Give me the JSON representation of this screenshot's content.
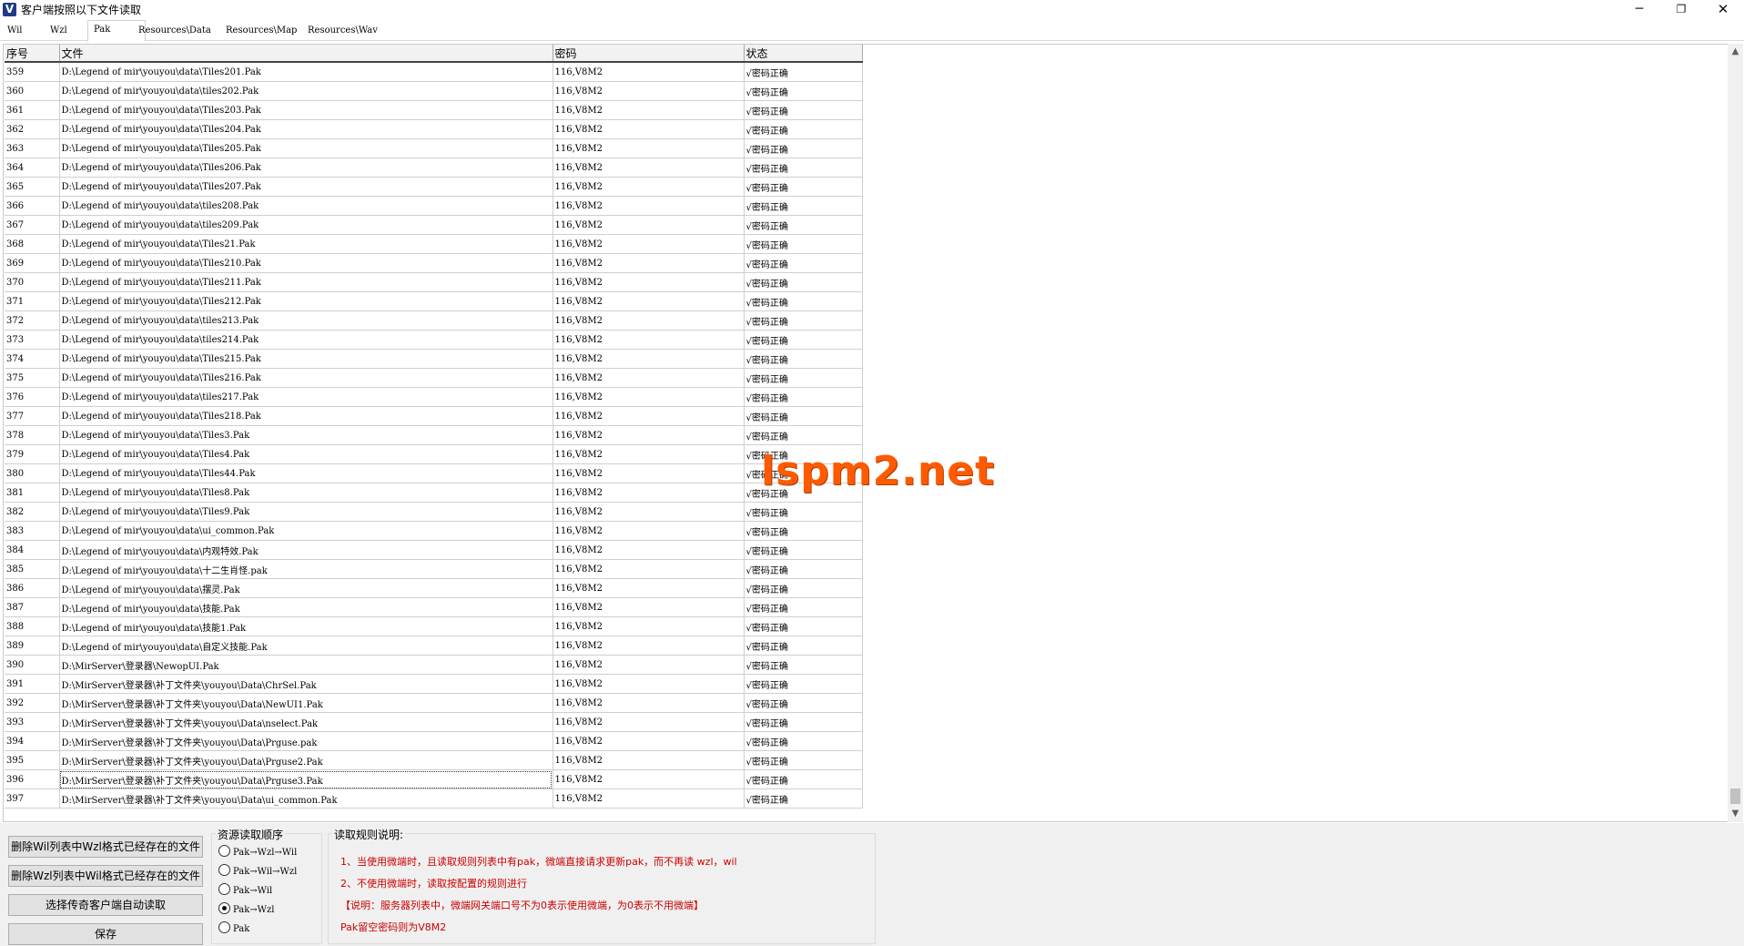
{
  "window": {
    "title": "客户端按照以下文件读取",
    "app_icon_letter": "V",
    "minimize_glyph": "─",
    "maximize_glyph": "❐",
    "close_glyph": "✕"
  },
  "tabs": [
    {
      "label": "Wil",
      "active": false
    },
    {
      "label": "Wzl",
      "active": false
    },
    {
      "label": "Pak",
      "active": true
    },
    {
      "label": "Resources\\Data",
      "active": false
    },
    {
      "label": "Resources\\Map",
      "active": false
    },
    {
      "label": "Resources\\Wav",
      "active": false
    }
  ],
  "table": {
    "headers": {
      "seq": "序号",
      "file": "文件",
      "password": "密码",
      "status": "状态"
    },
    "rows": [
      {
        "seq": "359",
        "file": "D:\\Legend of mir\\youyou\\data\\Tiles201.Pak",
        "password": "116,V8M2",
        "status": "√密码正确"
      },
      {
        "seq": "360",
        "file": "D:\\Legend of mir\\youyou\\data\\tiles202.Pak",
        "password": "116,V8M2",
        "status": "√密码正确"
      },
      {
        "seq": "361",
        "file": "D:\\Legend of mir\\youyou\\data\\Tiles203.Pak",
        "password": "116,V8M2",
        "status": "√密码正确"
      },
      {
        "seq": "362",
        "file": "D:\\Legend of mir\\youyou\\data\\Tiles204.Pak",
        "password": "116,V8M2",
        "status": "√密码正确"
      },
      {
        "seq": "363",
        "file": "D:\\Legend of mir\\youyou\\data\\Tiles205.Pak",
        "password": "116,V8M2",
        "status": "√密码正确"
      },
      {
        "seq": "364",
        "file": "D:\\Legend of mir\\youyou\\data\\Tiles206.Pak",
        "password": "116,V8M2",
        "status": "√密码正确"
      },
      {
        "seq": "365",
        "file": "D:\\Legend of mir\\youyou\\data\\Tiles207.Pak",
        "password": "116,V8M2",
        "status": "√密码正确"
      },
      {
        "seq": "366",
        "file": "D:\\Legend of mir\\youyou\\data\\tiles208.Pak",
        "password": "116,V8M2",
        "status": "√密码正确"
      },
      {
        "seq": "367",
        "file": "D:\\Legend of mir\\youyou\\data\\tiles209.Pak",
        "password": "116,V8M2",
        "status": "√密码正确"
      },
      {
        "seq": "368",
        "file": "D:\\Legend of mir\\youyou\\data\\Tiles21.Pak",
        "password": "116,V8M2",
        "status": "√密码正确"
      },
      {
        "seq": "369",
        "file": "D:\\Legend of mir\\youyou\\data\\Tiles210.Pak",
        "password": "116,V8M2",
        "status": "√密码正确"
      },
      {
        "seq": "370",
        "file": "D:\\Legend of mir\\youyou\\data\\Tiles211.Pak",
        "password": "116,V8M2",
        "status": "√密码正确"
      },
      {
        "seq": "371",
        "file": "D:\\Legend of mir\\youyou\\data\\Tiles212.Pak",
        "password": "116,V8M2",
        "status": "√密码正确"
      },
      {
        "seq": "372",
        "file": "D:\\Legend of mir\\youyou\\data\\tiles213.Pak",
        "password": "116,V8M2",
        "status": "√密码正确"
      },
      {
        "seq": "373",
        "file": "D:\\Legend of mir\\youyou\\data\\tiles214.Pak",
        "password": "116,V8M2",
        "status": "√密码正确"
      },
      {
        "seq": "374",
        "file": "D:\\Legend of mir\\youyou\\data\\Tiles215.Pak",
        "password": "116,V8M2",
        "status": "√密码正确"
      },
      {
        "seq": "375",
        "file": "D:\\Legend of mir\\youyou\\data\\Tiles216.Pak",
        "password": "116,V8M2",
        "status": "√密码正确"
      },
      {
        "seq": "376",
        "file": "D:\\Legend of mir\\youyou\\data\\tiles217.Pak",
        "password": "116,V8M2",
        "status": "√密码正确"
      },
      {
        "seq": "377",
        "file": "D:\\Legend of mir\\youyou\\data\\Tiles218.Pak",
        "password": "116,V8M2",
        "status": "√密码正确"
      },
      {
        "seq": "378",
        "file": "D:\\Legend of mir\\youyou\\data\\Tiles3.Pak",
        "password": "116,V8M2",
        "status": "√密码正确"
      },
      {
        "seq": "379",
        "file": "D:\\Legend of mir\\youyou\\data\\Tiles4.Pak",
        "password": "116,V8M2",
        "status": "√密码正确"
      },
      {
        "seq": "380",
        "file": "D:\\Legend of mir\\youyou\\data\\Tiles44.Pak",
        "password": "116,V8M2",
        "status": "√密码正确"
      },
      {
        "seq": "381",
        "file": "D:\\Legend of mir\\youyou\\data\\Tiles8.Pak",
        "password": "116,V8M2",
        "status": "√密码正确"
      },
      {
        "seq": "382",
        "file": "D:\\Legend of mir\\youyou\\data\\Tiles9.Pak",
        "password": "116,V8M2",
        "status": "√密码正确"
      },
      {
        "seq": "383",
        "file": "D:\\Legend of mir\\youyou\\data\\ui_common.Pak",
        "password": "116,V8M2",
        "status": "√密码正确"
      },
      {
        "seq": "384",
        "file": "D:\\Legend of mir\\youyou\\data\\内观特效.Pak",
        "password": "116,V8M2",
        "status": "√密码正确"
      },
      {
        "seq": "385",
        "file": "D:\\Legend of mir\\youyou\\data\\十二生肖怪.pak",
        "password": "116,V8M2",
        "status": "√密码正确"
      },
      {
        "seq": "386",
        "file": "D:\\Legend of mir\\youyou\\data\\摆灵.Pak",
        "password": "116,V8M2",
        "status": "√密码正确"
      },
      {
        "seq": "387",
        "file": "D:\\Legend of mir\\youyou\\data\\技能.Pak",
        "password": "116,V8M2",
        "status": "√密码正确"
      },
      {
        "seq": "388",
        "file": "D:\\Legend of mir\\youyou\\data\\技能1.Pak",
        "password": "116,V8M2",
        "status": "√密码正确"
      },
      {
        "seq": "389",
        "file": "D:\\Legend of mir\\youyou\\data\\自定义技能.Pak",
        "password": "116,V8M2",
        "status": "√密码正确"
      },
      {
        "seq": "390",
        "file": "D:\\MirServer\\登录器\\NewopUI.Pak",
        "password": "116,V8M2",
        "status": "√密码正确"
      },
      {
        "seq": "391",
        "file": "D:\\MirServer\\登录器\\补丁文件夹\\youyou\\Data\\ChrSel.Pak",
        "password": "116,V8M2",
        "status": "√密码正确"
      },
      {
        "seq": "392",
        "file": "D:\\MirServer\\登录器\\补丁文件夹\\youyou\\Data\\NewUI1.Pak",
        "password": "116,V8M2",
        "status": "√密码正确"
      },
      {
        "seq": "393",
        "file": "D:\\MirServer\\登录器\\补丁文件夹\\youyou\\Data\\nselect.Pak",
        "password": "116,V8M2",
        "status": "√密码正确"
      },
      {
        "seq": "394",
        "file": "D:\\MirServer\\登录器\\补丁文件夹\\youyou\\Data\\Prguse.pak",
        "password": "116,V8M2",
        "status": "√密码正确"
      },
      {
        "seq": "395",
        "file": "D:\\MirServer\\登录器\\补丁文件夹\\youyou\\Data\\Prguse2.Pak",
        "password": "116,V8M2",
        "status": "√密码正确"
      },
      {
        "seq": "396",
        "file": "D:\\MirServer\\登录器\\补丁文件夹\\youyou\\Data\\Prguse3.Pak",
        "password": "116,V8M2",
        "status": "√密码正确"
      },
      {
        "seq": "397",
        "file": "D:\\MirServer\\登录器\\补丁文件夹\\youyou\\Data\\ui_common.Pak",
        "password": "116,V8M2",
        "status": "√密码正确"
      }
    ],
    "focused_row": "396"
  },
  "scrollbar": {
    "up_glyph": "▲",
    "down_glyph": "▼"
  },
  "watermark": "lspm2.net",
  "buttons": {
    "delete_wil": "删除Wil列表中Wzl格式已经存在的文件",
    "delete_wzl": "删除Wzl列表中Wil格式已经存在的文件",
    "auto_read": "选择传奇客户端自动读取",
    "save": "保存"
  },
  "resource_order": {
    "title": "资源读取顺序",
    "options": [
      {
        "label": "Pak→Wzl→Wil",
        "checked": false
      },
      {
        "label": "Pak→Wil→Wzl",
        "checked": false
      },
      {
        "label": "Pak→Wil",
        "checked": false
      },
      {
        "label": "Pak→Wzl",
        "checked": true
      },
      {
        "label": "Pak",
        "checked": false
      }
    ]
  },
  "rules": {
    "title": "读取规则说明:",
    "lines": [
      "1、当使用微端时，且读取规则列表中有pak，微端直接请求更新pak，而不再读 wzl，wil",
      "2、不使用微端时，读取按配置的规则进行",
      "【说明：服务器列表中，微端网关端口号不为0表示使用微端，为0表示不用微端】",
      "Pak留空密码则为V8M2"
    ]
  },
  "colors": {
    "rules_text": "#cc0000",
    "watermark": "#ff5a00"
  }
}
